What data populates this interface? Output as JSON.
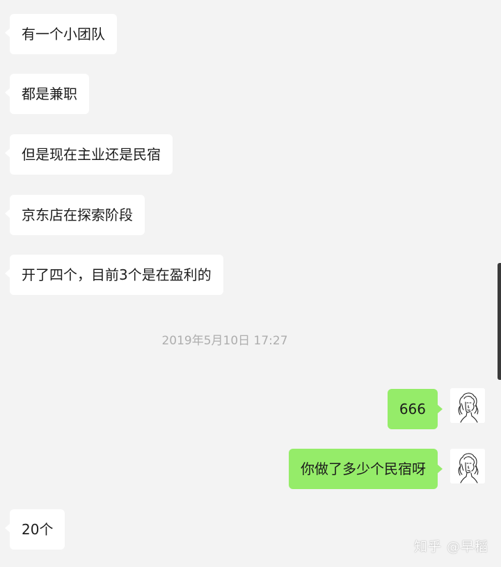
{
  "messages": [
    {
      "text": "有一个小团队"
    },
    {
      "text": "都是兼职"
    },
    {
      "text": "但是现在主业还是民宿"
    },
    {
      "text": "京东店在探索阶段"
    },
    {
      "text": "开了四个，目前3个是在盈利的"
    },
    {
      "text": "666"
    },
    {
      "text": "你做了多少个民宿呀"
    },
    {
      "text": "20个"
    }
  ],
  "timestamp": "2019年5月10日 17:27",
  "watermark": "知乎 @早稻"
}
